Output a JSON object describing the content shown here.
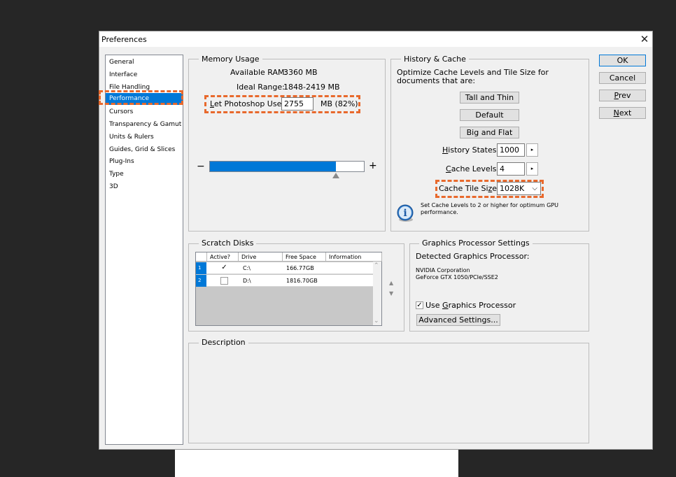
{
  "window": {
    "title": "Preferences",
    "close_glyph": "✕"
  },
  "sidebar": {
    "items": [
      {
        "label": "General"
      },
      {
        "label": "Interface"
      },
      {
        "label": "File Handling"
      },
      {
        "label": "Performance",
        "selected": true
      },
      {
        "label": "Cursors"
      },
      {
        "label": "Transparency & Gamut"
      },
      {
        "label": "Units & Rulers"
      },
      {
        "label": "Guides, Grid & Slices"
      },
      {
        "label": "Plug-Ins"
      },
      {
        "label": "Type"
      },
      {
        "label": "3D"
      }
    ]
  },
  "memory": {
    "title": "Memory Usage",
    "available_label": "Available RAM:",
    "available_value": "3360 MB",
    "ideal_label": "Ideal Range:",
    "ideal_value": "1848-2419 MB",
    "use_label_mnemonic": "L",
    "use_label_rest": "et Photoshop Use:",
    "use_value": "2755",
    "use_unit": "MB (82%)",
    "slider_fraction": 0.82,
    "minus": "−",
    "plus": "+"
  },
  "history": {
    "title": "History & Cache",
    "intro_line1": "Optimize Cache Levels and Tile Size for",
    "intro_line2": "documents that are:",
    "btn_tall": "Tall and Thin",
    "btn_default": "Default",
    "btn_big": "Big and Flat",
    "history_states_mn": "H",
    "history_states_rest": "istory States:",
    "history_states_value": "1000",
    "cache_levels_mn": "C",
    "cache_levels_rest": "ache Levels:",
    "cache_levels_value": "4",
    "tile_size_pre": "Cache Tile Si",
    "tile_size_mn": "z",
    "tile_size_post": "e:",
    "tile_size_value": "1028K",
    "info_line1": "Set Cache Levels to 2 or higher for optimum GPU",
    "info_line2": "performance.",
    "info_icon": "i",
    "spin_glyph": "▸",
    "dropdown_glyph": "⌵"
  },
  "scratch": {
    "title": "Scratch Disks",
    "columns": [
      "Active?",
      "Drive",
      "Free Space",
      "Information"
    ],
    "rows": [
      {
        "num": "1",
        "active": "✓",
        "drive": "C:\\",
        "free": "166.77GB",
        "info": ""
      },
      {
        "num": "2",
        "active": "",
        "drive": "D:\\",
        "free": "1816.70GB",
        "info": ""
      }
    ],
    "up_arrow": "▲",
    "down_arrow": "▼",
    "scroll_up": "⌃",
    "scroll_down": "⌄"
  },
  "gpu": {
    "title": "Graphics Processor Settings",
    "detected_label": "Detected Graphics Processor:",
    "vendor": "NVIDIA Corporation",
    "model": "GeForce GTX 1050/PCIe/SSE2",
    "use_pre": "Use ",
    "use_mn": "G",
    "use_post": "raphics Processor",
    "use_checked": "✓",
    "advanced_btn": "Advanced Settings..."
  },
  "description": {
    "title": "Description"
  },
  "buttons": {
    "ok": "OK",
    "cancel": "Cancel",
    "prev_mn": "P",
    "prev_rest": "rev",
    "next_mn": "N",
    "next_rest": "ext"
  },
  "colors": {
    "highlight": "#0078d7",
    "annotation": "#e8692c"
  }
}
